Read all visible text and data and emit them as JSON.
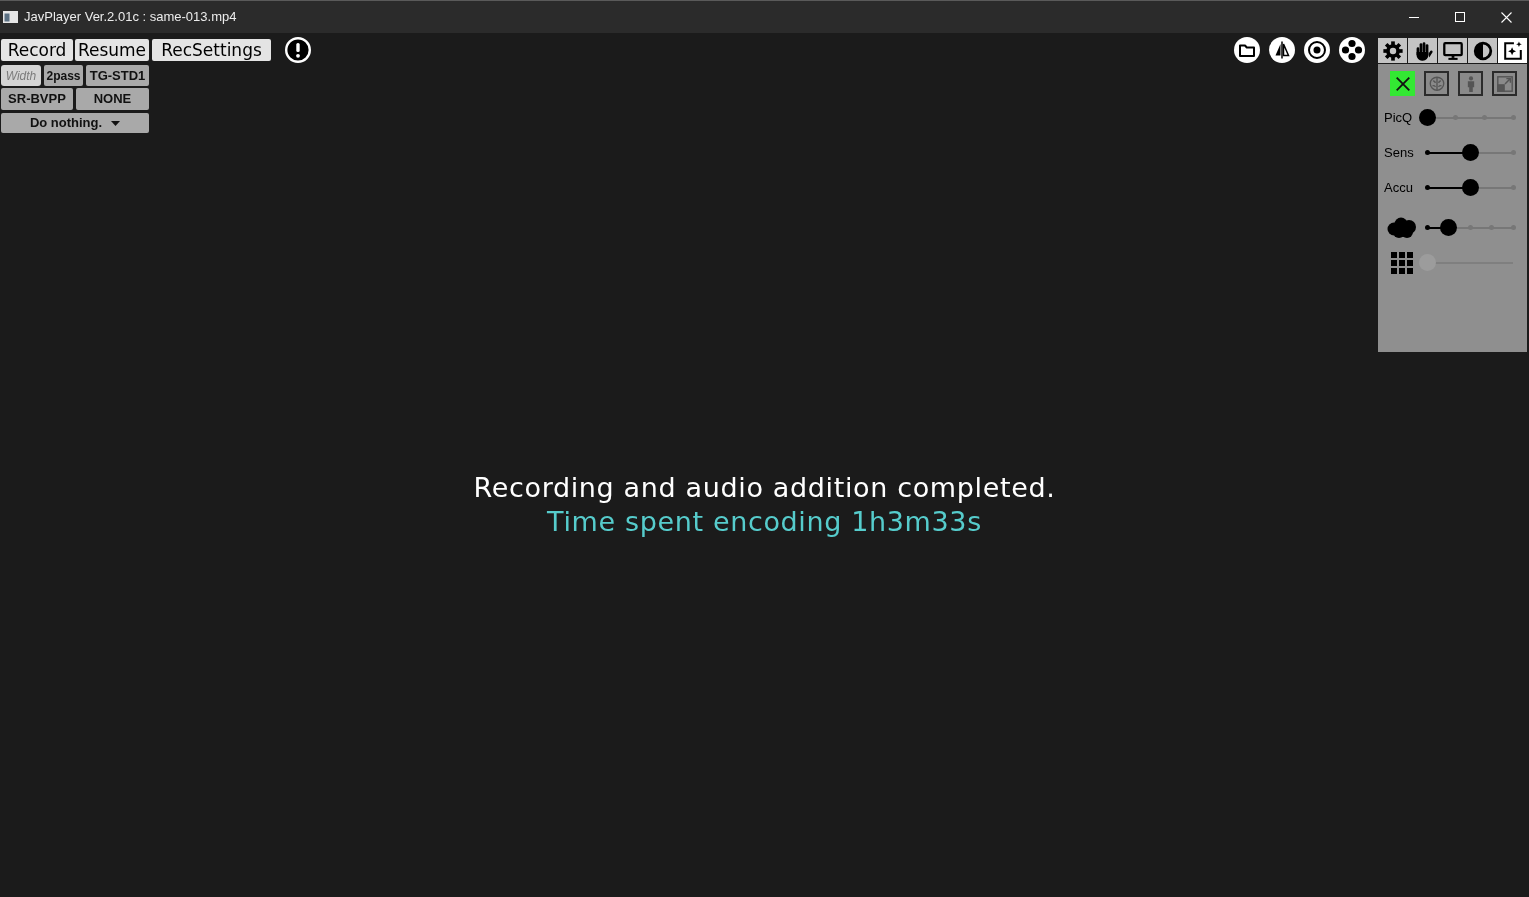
{
  "window": {
    "title": "JavPlayer Ver.2.01c : same-013.mp4"
  },
  "record_bar": {
    "buttons": [
      {
        "label": "Record"
      },
      {
        "label": "Resume"
      },
      {
        "label": "RecSettings"
      }
    ]
  },
  "encoder": {
    "width_field": {
      "placeholder": "Width"
    },
    "option_rows": [
      [
        "2pass",
        "TG-STD1"
      ],
      [
        "SR-BVPP",
        "NONE"
      ]
    ],
    "after_recording": {
      "value": "Do nothing."
    }
  },
  "mode_buttons": [
    {
      "selected": false
    },
    {
      "selected": false
    },
    {
      "selected": false
    },
    {
      "selected": false
    },
    {
      "selected": true
    }
  ],
  "panel": {
    "tool_buttons": [
      {
        "selected": true
      },
      {
        "selected": false
      },
      {
        "selected": false
      },
      {
        "selected": false
      }
    ],
    "sliders": [
      {
        "kind": "text",
        "label": "PicQ",
        "level": 0,
        "disabled": false
      },
      {
        "kind": "text",
        "label": "Sens",
        "level": 0.5,
        "disabled": false
      },
      {
        "kind": "text",
        "label": "Accu",
        "level": 0.5,
        "disabled": false
      },
      {
        "kind": "icon",
        "level": 0.25,
        "disabled": false
      },
      {
        "kind": "icon",
        "level": 0,
        "disabled": true
      }
    ]
  },
  "message": {
    "status": "Recording and audio addition completed.",
    "detail": "Time spent encoding 1h3m33s"
  }
}
